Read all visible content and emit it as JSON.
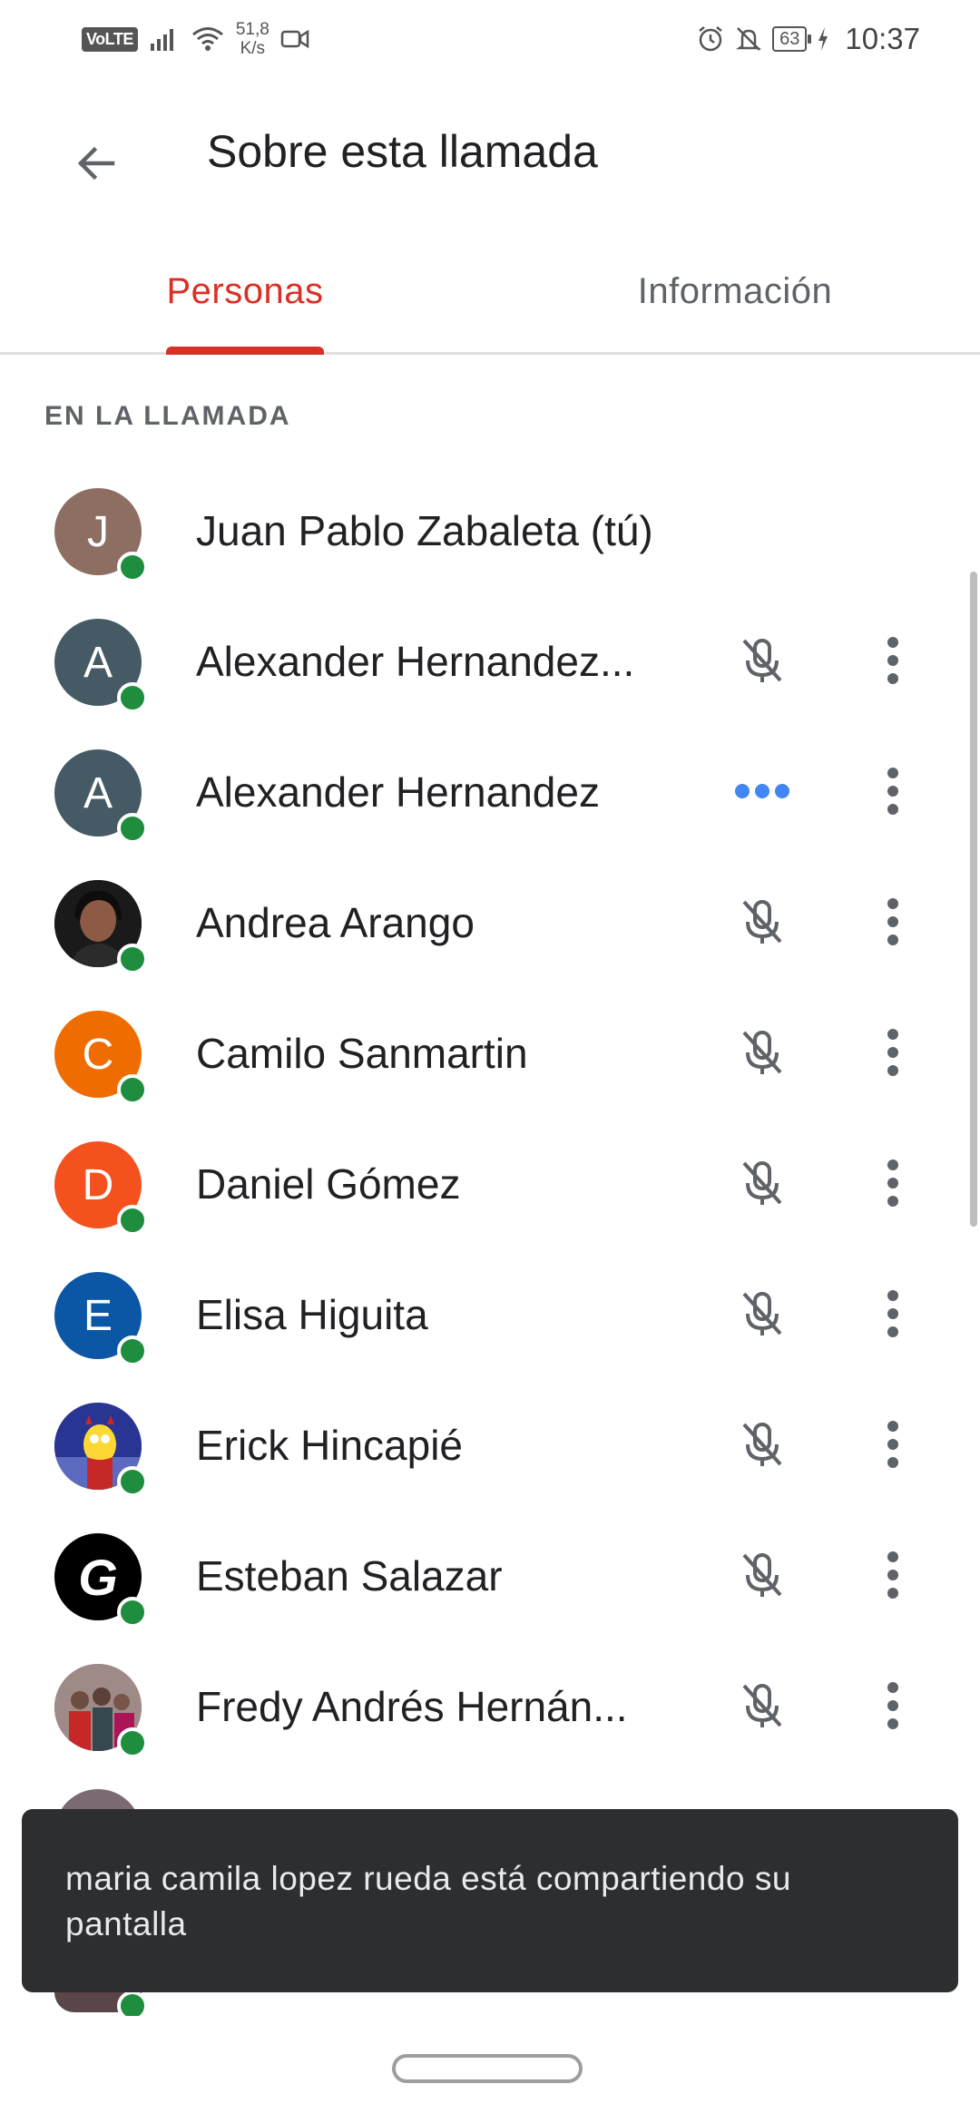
{
  "status_bar": {
    "volte": "VoLTE",
    "speed_value": "51,8",
    "speed_unit": "K/s",
    "battery": "63",
    "time": "10:37"
  },
  "app_bar": {
    "title": "Sobre esta llamada",
    "back_icon": "arrow-back-icon"
  },
  "tabs": [
    {
      "label": "Personas",
      "active": true
    },
    {
      "label": "Información",
      "active": false
    }
  ],
  "section_header": "EN LA LLAMADA",
  "participants": [
    {
      "initial": "J",
      "name": "Juan Pablo Zabaleta (tú)",
      "avatar_color": "#8d6e63",
      "status": "none"
    },
    {
      "initial": "A",
      "name": "Alexander Hernandez...",
      "avatar_color": "#455a64",
      "status": "muted"
    },
    {
      "initial": "A",
      "name": "Alexander Hernandez",
      "avatar_color": "#455a64",
      "status": "speaking"
    },
    {
      "initial": "",
      "name": "Andrea Arango",
      "avatar_color": "#2b2b2b",
      "status": "muted"
    },
    {
      "initial": "C",
      "name": "Camilo Sanmartin",
      "avatar_color": "#ef6c00",
      "status": "muted"
    },
    {
      "initial": "D",
      "name": "Daniel Gómez",
      "avatar_color": "#f4511e",
      "status": "muted"
    },
    {
      "initial": "E",
      "name": "Elisa Higuita",
      "avatar_color": "#0b57a6",
      "status": "muted"
    },
    {
      "initial": "",
      "name": "Erick Hincapié",
      "avatar_color": "#3949ab",
      "status": "muted"
    },
    {
      "initial": "G",
      "name": "Esteban Salazar",
      "avatar_color": "#000000",
      "status": "muted"
    },
    {
      "initial": "",
      "name": "Fredy Andrés Hernán...",
      "avatar_color": "#8a6f6a",
      "status": "muted"
    }
  ],
  "snackbar": {
    "message": "maria camila lopez rueda está compartiendo su pantalla"
  },
  "colors": {
    "accent": "#d93025",
    "online": "#1e8e3e",
    "speaking": "#4285f4"
  }
}
